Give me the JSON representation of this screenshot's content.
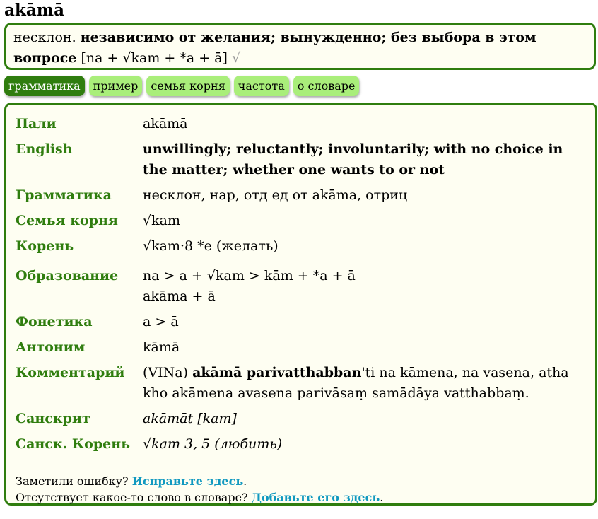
{
  "headword": "akāmā",
  "summary": {
    "pos": "несклон.",
    "meaning": "независимо от желания; вынужденно; без выбора в этом вопросе",
    "construction": "[na + √kam + *a + ā]",
    "root_mark": "√"
  },
  "tabs": [
    {
      "label": "грамматика",
      "active": true
    },
    {
      "label": "пример",
      "active": false
    },
    {
      "label": "семья корня",
      "active": false
    },
    {
      "label": "частота",
      "active": false
    },
    {
      "label": "о словаре",
      "active": false
    }
  ],
  "grammar": {
    "pali": {
      "label": "Пали",
      "value": "akāmā"
    },
    "english": {
      "label": "English",
      "value": "unwillingly; reluctantly; involuntarily; with no choice in the matter; whether one wants to or not"
    },
    "grammar": {
      "label": "Грамматика",
      "value": "несклон, нар, отд ед от akāma, отриц"
    },
    "root_family": {
      "label": "Семья корня",
      "value": "√kam"
    },
    "root": {
      "label": "Корень",
      "value": "√kam·8 *e (желать)"
    },
    "formation": {
      "label": "Образование",
      "line1": "na > a + √kam > kām + *a + ā",
      "line2": "akāma + ā"
    },
    "phonetics": {
      "label": "Фонетика",
      "value": "a > ā"
    },
    "antonym": {
      "label": "Антоним",
      "value": "kāmā"
    },
    "commentary": {
      "label": "Комментарий",
      "prefix": "(VINa)",
      "bold": "akāmā parivatthabban",
      "rest": "'ti na kāmena, na vasena, atha kho akāmena avasena parivāsaṃ samādāya vatthabbaṃ."
    },
    "sanskrit": {
      "label": "Санскрит",
      "value": "akāmāt [kam]"
    },
    "sanskrit_root": {
      "label": "Санск. Корень",
      "value": "√kam 3, 5 (любить)"
    }
  },
  "footer": {
    "error_text": "Заметили ошибку?",
    "error_link": "Исправьте здесь",
    "missing_text": "Отсутствует какое-то слово в словаре?",
    "missing_link": "Добавьте его здесь"
  }
}
